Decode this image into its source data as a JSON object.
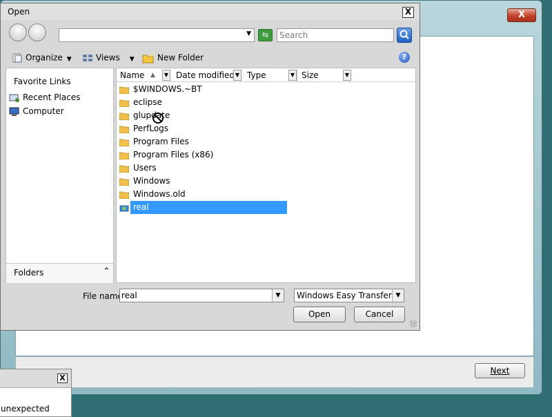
{
  "background_window": {
    "close_glyph": "X",
    "next_label": "Next"
  },
  "small_dialog": {
    "close_glyph": "X",
    "message": "unexpected"
  },
  "dialog": {
    "title": "Open",
    "close_glyph": "X",
    "address_value": "",
    "search_placeholder": "Search",
    "toolbar": {
      "organize": "Organize",
      "views": "Views",
      "new_folder": "New Folder"
    },
    "navigation": {
      "heading": "Favorite Links",
      "links": [
        "Recent Places",
        "Computer"
      ],
      "folders_label": "Folders"
    },
    "columns": [
      "Name",
      "Date modified",
      "Type",
      "Size"
    ],
    "files": [
      {
        "name": "$WINDOWS.~BT",
        "icon": "folder-icon"
      },
      {
        "name": "eclipse",
        "icon": "folder-icon"
      },
      {
        "name": "glupdate",
        "icon": "folder-icon"
      },
      {
        "name": "PerfLogs",
        "icon": "folder-icon"
      },
      {
        "name": "Program Files",
        "icon": "folder-icon"
      },
      {
        "name": "Program Files (x86)",
        "icon": "folder-icon"
      },
      {
        "name": "Users",
        "icon": "folder-icon"
      },
      {
        "name": "Windows",
        "icon": "folder-icon"
      },
      {
        "name": "Windows.old",
        "icon": "folder-icon"
      },
      {
        "name": "real",
        "icon": "transfer-file-icon",
        "selected": true
      }
    ],
    "file_name_label": "File name:",
    "file_name_value": "real",
    "file_type": "Windows Easy Transfer (*.MIG)",
    "open_label": "Open",
    "cancel_label": "Cancel"
  },
  "colors": {
    "selection": "#3399ff",
    "desktop": "#2f6f74"
  }
}
